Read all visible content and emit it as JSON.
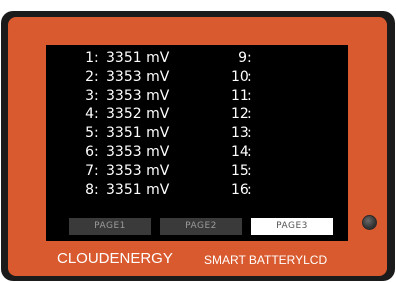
{
  "colors": {
    "panel": "#d95a2e",
    "bezel": "#1b1b1b",
    "screen": "#000000",
    "text": "#ffffff",
    "page_button": "#3a3a3a",
    "page_button_active": "#ffffff"
  },
  "cells_left": [
    {
      "index": "1",
      "value": "3351 mV"
    },
    {
      "index": "2",
      "value": "3353 mV"
    },
    {
      "index": "3",
      "value": "3353 mV"
    },
    {
      "index": "4",
      "value": "3352 mV"
    },
    {
      "index": "5",
      "value": "3351 mV"
    },
    {
      "index": "6",
      "value": "3353 mV"
    },
    {
      "index": "7",
      "value": "3353 mV"
    },
    {
      "index": "8",
      "value": "3351 mV"
    }
  ],
  "cells_right": [
    {
      "index": "9",
      "value": ""
    },
    {
      "index": "10",
      "value": ""
    },
    {
      "index": "11",
      "value": ""
    },
    {
      "index": "12",
      "value": ""
    },
    {
      "index": "13",
      "value": ""
    },
    {
      "index": "14",
      "value": ""
    },
    {
      "index": "15",
      "value": ""
    },
    {
      "index": "16",
      "value": ""
    }
  ],
  "pages": [
    {
      "label": "PAGE1",
      "active": false
    },
    {
      "label": "PAGE2",
      "active": false
    },
    {
      "label": "PAGE3",
      "active": true
    }
  ],
  "brand": {
    "name": "CLOUDENERGY",
    "subtitle": "SMART BATTERYLCD"
  },
  "icons": {
    "knob": "round-knob-icon"
  }
}
